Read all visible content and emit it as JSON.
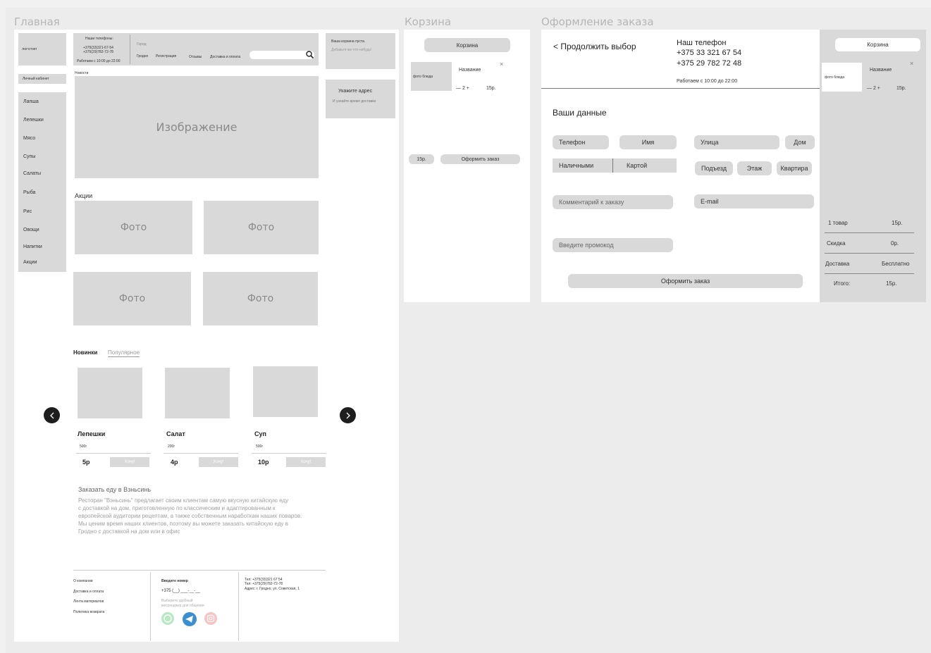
{
  "frames": {
    "home": "Главная",
    "cart": "Корзина",
    "checkout": "Оформление заказа"
  },
  "home": {
    "logo": "логотип",
    "phones_title": "Наши телефоны:",
    "phone1": "+375(33)321-67-54",
    "phone2": "+375(29)782-72-78",
    "hours": "Работаем с 10:00 до 22:00",
    "city_label": "Город",
    "city": "Гродно",
    "nav": [
      "Регистрация",
      "Отзывы",
      "Доставка и оплата"
    ],
    "cart_empty": "Ваша корзина пуста.",
    "cart_empty_sub": "Добавьте же что-нибудь!",
    "address_title": "Укажите адрес",
    "address_sub": "И узнайте время доставки",
    "account": "Личный кабинет",
    "menu": [
      "Лапша",
      "Лепешки",
      "Мясо",
      "Супы",
      "Салаты",
      "Рыба",
      "Рис",
      "Овощи",
      "Напитки",
      "Акции"
    ],
    "news_label": "Новости",
    "image_placeholder": "Изображение",
    "promos_label": "Акции",
    "photo": "Фото",
    "tab_new": "Новинки",
    "tab_popular": "Популярное",
    "products": [
      {
        "name": "Лепешки",
        "weight": "500г",
        "price": "5р",
        "btn": "Хочу!"
      },
      {
        "name": "Салат",
        "weight": "200г",
        "price": "4р",
        "btn": "Хочу!"
      },
      {
        "name": "Суп",
        "weight": "500г",
        "price": "10р",
        "btn": "Хочу!"
      }
    ],
    "about_title": "Заказать еду в Взньсинь",
    "about_lines": [
      "Ресторан \"Вэньсинь\" предлагает своим клиентам самую вкусную китайскую еду",
      "с доставкой на дом, приготовленную по классическим и адаптированным к",
      "европейской аудитории рецептам, а также собственным наработкам наших поваров.",
      "Мы ценим время наших клиентов, поэтому вы можете заказать китайскую еду в",
      " Гродно с доставкой на дом или в офис"
    ],
    "footer_links": [
      "О компании",
      "Доставка и оплата",
      "Лента материалов",
      "Политика возврата"
    ],
    "footer_phone_title": "Введите номер",
    "footer_phone_mask": "+375 (__) ___-__-__",
    "footer_messenger": [
      "Выберите удобный",
      "мессенджер для общения"
    ],
    "footer_contacts": [
      "Тел: +375(33)321 67 54",
      "Тел: +375(29)782-72-78",
      "Адрес: г. Гродно, ул. Советская, 1"
    ]
  },
  "cart": {
    "title": "Корзина",
    "item_photo": "фото блюда",
    "item_name": "Название",
    "qty": "— 2 +",
    "item_price": "15р.",
    "total": "15р.",
    "checkout_btn": "Оформить заказ"
  },
  "checkout": {
    "back": "< Продолжить выбор",
    "phone_title": "Наш телефон",
    "phone1": "+375 33 321 67 54",
    "phone2": "+375 29 782 72 48",
    "hours": "Работаем с 10:00 до 22:00",
    "your_data": "Ваши данные",
    "fields": {
      "phone": "Телефон",
      "name": "Имя",
      "street": "Улица",
      "house": "Дом",
      "cash": "Наличными",
      "card": "Картой",
      "entrance": "Подъезд",
      "floor": "Этаж",
      "apartment": "Квартира",
      "comment": "Комментарий к заказу",
      "email": "E-mail",
      "promo": "Введите промокод"
    },
    "submit": "Оформить заказ",
    "side": {
      "title": "Корзина",
      "item_photo": "фото блюда",
      "item_name": "Название",
      "qty": "— 2 +",
      "item_price": "15р.",
      "summary": [
        {
          "label": "1 товар",
          "value": "15р."
        },
        {
          "label": "Скидка",
          "value": "0р."
        },
        {
          "label": "Доставка",
          "value": "Бесплатно"
        },
        {
          "label": "Итого:",
          "value": "15р."
        }
      ]
    }
  }
}
